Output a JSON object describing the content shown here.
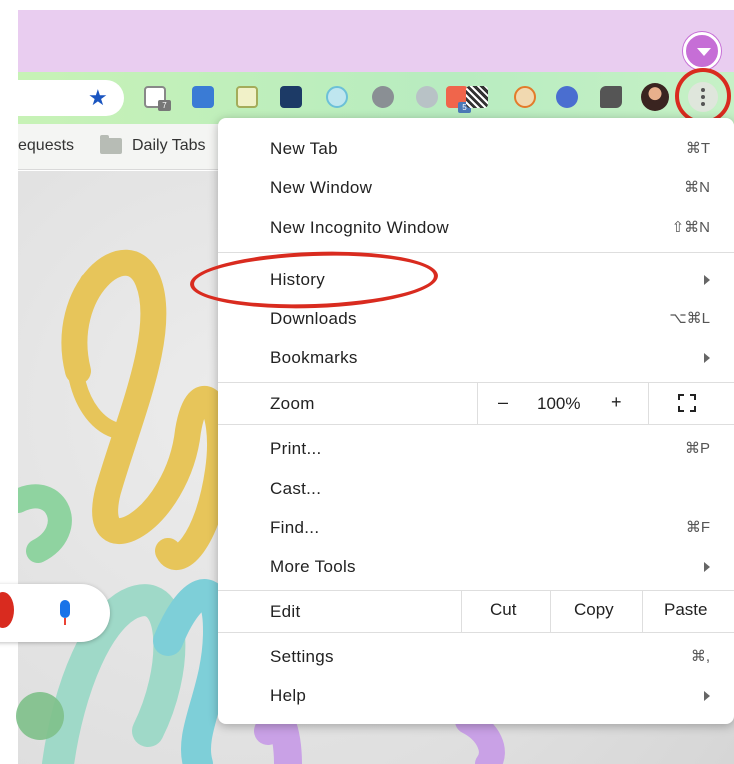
{
  "toolbar": {
    "extension_icons": [
      "gmail-icon",
      "pencil-extension-icon",
      "clipboard-extension-icon",
      "screen-capture-icon",
      "smiley-extension-icon",
      "sphere-extension-icon",
      "video-extension-icon",
      "qr-code-icon",
      "pinterest-extension-icon",
      "snowflake-extension-icon",
      "puzzle-icon"
    ],
    "gmail_badge": "7",
    "video_badge": "5"
  },
  "bookmarks_bar": {
    "items": [
      "equests",
      "Daily Tabs"
    ]
  },
  "menu": {
    "new_tab": {
      "label": "New Tab",
      "shortcut": "⌘T"
    },
    "new_window": {
      "label": "New Window",
      "shortcut": "⌘N"
    },
    "new_incognito": {
      "label": "New Incognito Window",
      "shortcut": "⇧⌘N"
    },
    "history": {
      "label": "History"
    },
    "downloads": {
      "label": "Downloads",
      "shortcut": "⌥⌘L"
    },
    "bookmarks": {
      "label": "Bookmarks"
    },
    "zoom": {
      "label": "Zoom",
      "minus": "–",
      "value": "100%",
      "plus": "+"
    },
    "print": {
      "label": "Print...",
      "shortcut": "⌘P"
    },
    "cast": {
      "label": "Cast..."
    },
    "find": {
      "label": "Find...",
      "shortcut": "⌘F"
    },
    "more_tools": {
      "label": "More Tools"
    },
    "edit": {
      "label": "Edit",
      "cut": "Cut",
      "copy": "Copy",
      "paste": "Paste"
    },
    "settings": {
      "label": "Settings",
      "shortcut": "⌘,"
    },
    "help": {
      "label": "Help"
    }
  },
  "colors": {
    "annotation_red": "#d92b1f",
    "titlebar": "#e9cdf0",
    "toolbar": "#c7f2b6",
    "profile": "#c66ed6"
  }
}
